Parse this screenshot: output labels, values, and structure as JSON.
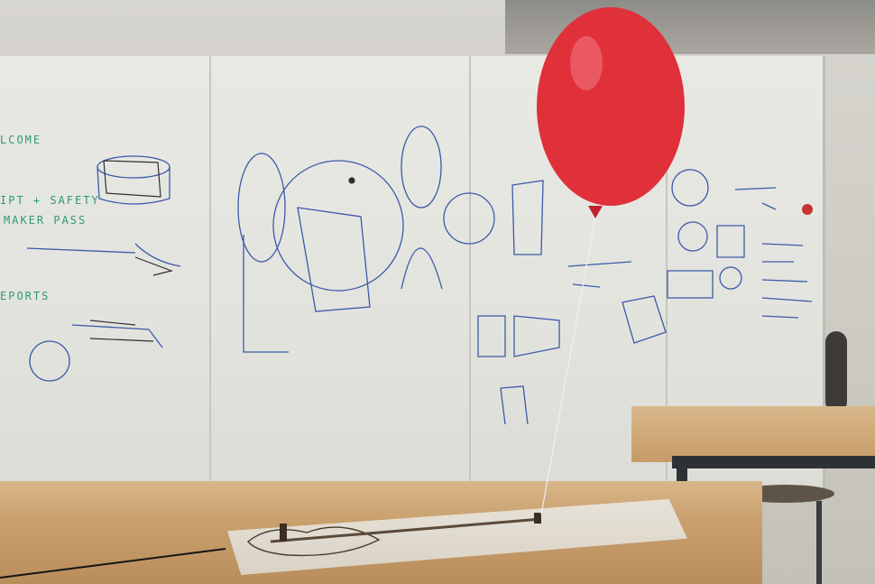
{
  "whiteboard": {
    "text_lines": [
      "LCOME",
      "IPT + SAFETY",
      "MAKER PASS",
      "EPORTS"
    ]
  },
  "colors": {
    "balloon": "#e0303a",
    "marker_green": "#2f9b72",
    "marker_blue": "#3b5aa8",
    "tabletop": "#d2ab7b"
  }
}
